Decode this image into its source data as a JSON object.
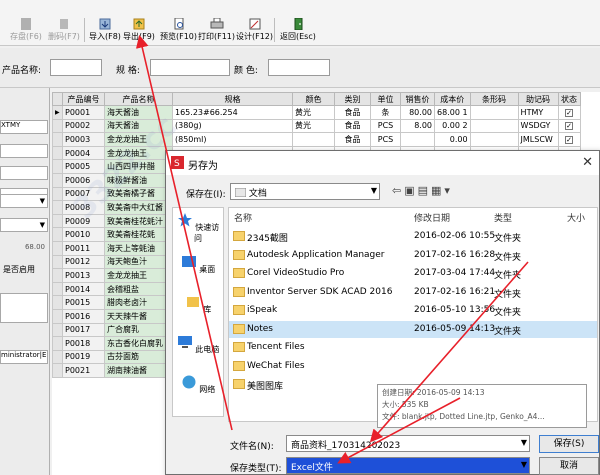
{
  "toolbar": {
    "buttons": [
      {
        "label": "存盘(F6)"
      },
      {
        "label": "删码(F7)"
      },
      {
        "label": "导入(F8)"
      },
      {
        "label": "导出(F9)"
      },
      {
        "label": "预览(F10)"
      },
      {
        "label": "打印(F11)"
      },
      {
        "label": "设计(F12)"
      },
      {
        "label": "返回(Esc)"
      }
    ]
  },
  "search": {
    "name_label": "产品名称:",
    "spec_label": "规    格:",
    "color_label": "颜    色:"
  },
  "left_panel": {
    "field1": "XTMY",
    "value1": "68.00",
    "toggle_label": "是否启用",
    "field_user": "ministrator|E"
  },
  "grid": {
    "columns": [
      "产品编号",
      "产品名称",
      "规格",
      "颜色",
      "类别",
      "单位",
      "销售价",
      "成本价",
      "条形码",
      "助记码",
      "状态"
    ],
    "rows": [
      [
        "P0001",
        "海天酱油",
        "165.23#66.254",
        "黄光",
        "食品",
        "条",
        "80.00",
        "68.00 1",
        "",
        "HTMY",
        "✓"
      ],
      [
        "P0002",
        "海天酱油",
        "(380g)",
        "黄光",
        "食品",
        "PCS",
        "8.00",
        "0.00 2",
        "",
        "WSDGY",
        "✓"
      ],
      [
        "P0003",
        "金龙龙抽王",
        "(850ml)",
        "",
        "食品",
        "PCS",
        "",
        "0.00",
        "",
        "JMLSCW",
        "✓"
      ],
      [
        "P0004",
        "金龙龙抽王",
        "",
        "",
        "",
        "",
        "",
        "",
        "",
        "",
        ""
      ],
      [
        "P0005",
        "山西四甲井醋",
        "",
        "",
        "",
        "",
        "",
        "",
        "",
        "",
        ""
      ],
      [
        "P0006",
        "味极鲜酱油",
        "",
        "",
        "",
        "",
        "",
        "",
        "",
        "",
        ""
      ],
      [
        "P0007",
        "致美斋橘子酱",
        "",
        "",
        "",
        "",
        "",
        "",
        "",
        "",
        ""
      ],
      [
        "P0008",
        "致美斋中大红酱",
        "",
        "",
        "",
        "",
        "",
        "",
        "",
        "",
        ""
      ],
      [
        "P0009",
        "致美斋桂花蚝汁",
        "",
        "",
        "",
        "",
        "",
        "",
        "",
        "",
        ""
      ],
      [
        "P0010",
        "致美斋桂花蚝",
        "",
        "",
        "",
        "",
        "",
        "",
        "",
        "",
        ""
      ],
      [
        "P0011",
        "海天上等蚝油",
        "",
        "",
        "",
        "",
        "",
        "",
        "",
        "",
        ""
      ],
      [
        "P0012",
        "海天鲍鱼汁",
        "",
        "",
        "",
        "",
        "",
        "",
        "",
        "",
        ""
      ],
      [
        "P0013",
        "金龙龙抽王",
        "",
        "",
        "",
        "",
        "",
        "",
        "",
        "",
        ""
      ],
      [
        "P0014",
        "会稽粗盐",
        "",
        "",
        "",
        "",
        "",
        "",
        "",
        "",
        ""
      ],
      [
        "P0015",
        "腊肉老卤汁",
        "",
        "",
        "",
        "",
        "",
        "",
        "",
        "",
        ""
      ],
      [
        "P0016",
        "天天辣牛酱",
        "",
        "",
        "",
        "",
        "",
        "",
        "",
        "",
        ""
      ],
      [
        "P0017",
        "广合腐乳",
        "",
        "",
        "",
        "",
        "",
        "",
        "",
        "",
        ""
      ],
      [
        "P0018",
        "东古香化白腐乳",
        "",
        "",
        "",
        "",
        "",
        "",
        "",
        "",
        ""
      ],
      [
        "P0019",
        "古芬面筋",
        "",
        "",
        "",
        "",
        "",
        "",
        "",
        "",
        ""
      ],
      [
        "P0021",
        "湖南辣油酱",
        "",
        "",
        "",
        "",
        "",
        "",
        "",
        "",
        ""
      ]
    ]
  },
  "dialog": {
    "title": "另存为",
    "save_in_label": "保存在(I):",
    "save_in_value": "文档",
    "col_name": "名称",
    "col_date": "修改日期",
    "col_type": "类型",
    "col_size": "大小",
    "places": [
      {
        "label": "快速访问"
      },
      {
        "label": "桌面"
      },
      {
        "label": "库"
      },
      {
        "label": "此电脑"
      },
      {
        "label": "网络"
      }
    ],
    "files": [
      {
        "name": "2345截图",
        "date": "2016-02-06 10:55",
        "type": "文件夹"
      },
      {
        "name": "Autodesk Application Manager",
        "date": "2017-02-16 16:28",
        "type": "文件夹"
      },
      {
        "name": "Corel VideoStudio Pro",
        "date": "2017-03-04 17:44",
        "type": "文件夹"
      },
      {
        "name": "Inventor Server SDK ACAD 2016",
        "date": "2017-02-16 16:21",
        "type": "文件夹"
      },
      {
        "name": "iSpeak",
        "date": "2016-05-10 13:56",
        "type": "文件夹"
      },
      {
        "name": "Notes",
        "date": "2016-05-09 14:13",
        "type": "文件夹"
      },
      {
        "name": "Tencent Files",
        "date": "",
        "type": ""
      },
      {
        "name": "WeChat Files",
        "date": "",
        "type": ""
      },
      {
        "name": "美图图库",
        "date": "",
        "type": ""
      }
    ],
    "tooltip": {
      "created": "创建日期: 2016-05-09 14:13",
      "size": "大小: 535 KB",
      "files": "文件: blank.jtp, Dotted Line.jtp, Genko_A4..."
    },
    "filename_label": "文件名(N):",
    "filename_value": "商品资料_170314202023",
    "filetype_label": "保存类型(T):",
    "filetype_value": "Excel文件",
    "save_button": "保存(S)",
    "cancel_button": "取消"
  },
  "colors": {
    "selection": "#cce4f7",
    "annotation_arrow": "#e8202a",
    "filetype_highlight": "#1e50d8",
    "name_cell": "#d9ecd9"
  }
}
